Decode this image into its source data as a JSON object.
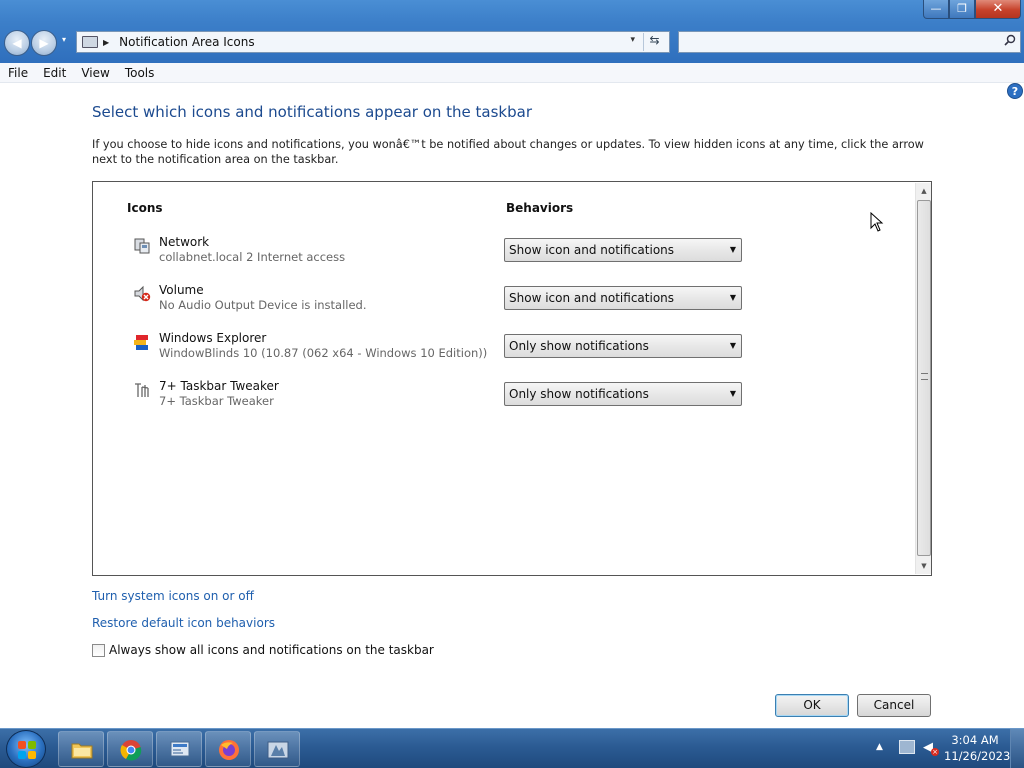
{
  "window": {
    "controls": {
      "minimize": "—",
      "maximize": "❐",
      "close": "✕"
    }
  },
  "nav": {
    "back": "◀",
    "forward": "▶",
    "dropdown": "▾"
  },
  "address": {
    "arrow": "▶",
    "path": "Notification Area Icons",
    "dropdown": "▾",
    "refresh": "⇆"
  },
  "search": {
    "placeholder": "",
    "icon": "search-icon"
  },
  "menu": {
    "items": [
      "File",
      "Edit",
      "View",
      "Tools"
    ]
  },
  "help": {
    "label": "?"
  },
  "page": {
    "title": "Select which icons and notifications appear on the taskbar",
    "description": "If you choose to hide icons and notifications, you wonâ€™t be notified about changes or updates. To view hidden icons at any time, click the arrow next to the notification area on the taskbar."
  },
  "list": {
    "headers": {
      "icons": "Icons",
      "behaviors": "Behaviors"
    },
    "rows": [
      {
        "name": "Network",
        "sub": "collabnet.local 2 Internet access",
        "behavior": "Show icon and notifications",
        "icon": "network-icon"
      },
      {
        "name": "Volume",
        "sub": "No Audio Output Device is installed.",
        "behavior": "Show icon and notifications",
        "icon": "volume-icon"
      },
      {
        "name": "Windows Explorer",
        "sub": "WindowBlinds 10 (10.87 (062 x64 - Windows 10 Edition))",
        "behavior": "Only show notifications",
        "icon": "windowblinds-icon"
      },
      {
        "name": "7+ Taskbar Tweaker",
        "sub": "7+ Taskbar Tweaker",
        "behavior": "Only show notifications",
        "icon": "taskbar-tweaker-icon"
      }
    ],
    "dropdown_arrow": "▼",
    "scroll_up": "▲",
    "scroll_down": "▼"
  },
  "links": {
    "system_icons": "Turn system icons on or off",
    "restore": "Restore default icon behaviors"
  },
  "checkbox": {
    "label": "Always show all icons and notifications on the taskbar",
    "checked": false
  },
  "buttons": {
    "ok": "OK",
    "cancel": "Cancel"
  },
  "taskbar": {
    "apps": [
      "file-explorer",
      "chrome",
      "control-panel",
      "firefox",
      "taskbar-tweaker"
    ],
    "tray_arrow": "▲",
    "clock": {
      "time": "3:04 AM",
      "date": "11/26/2023"
    }
  }
}
